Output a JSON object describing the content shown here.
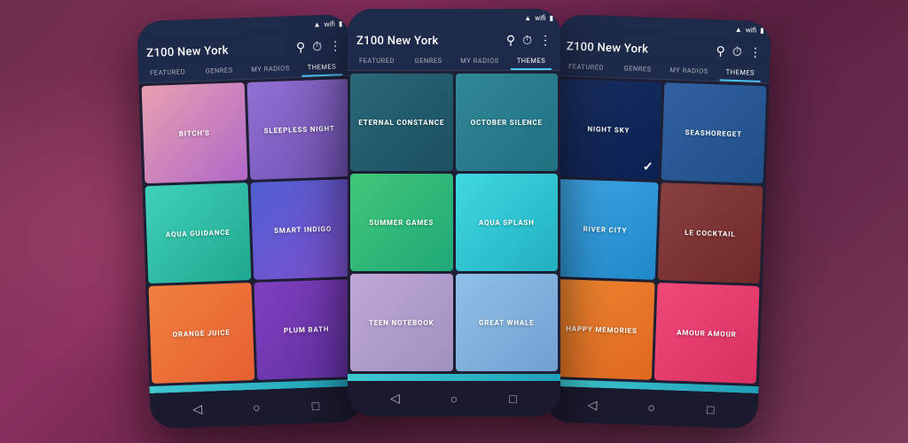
{
  "phones": [
    {
      "id": "phone-1",
      "header": {
        "title": "Z100 New York",
        "icons": [
          "search",
          "alarm",
          "more"
        ]
      },
      "nav": {
        "tabs": [
          "FEATURED",
          "GENRES",
          "MY RADIOS",
          "THEMES"
        ],
        "active": "THEMES"
      },
      "themes": [
        {
          "id": "bitchs",
          "label": "BITCH'S",
          "gradient": "gradient-pink-purple",
          "checked": false
        },
        {
          "id": "sleepless-night",
          "label": "SLEEPLESS NIGHT",
          "gradient": "gradient-light-purple",
          "checked": false
        },
        {
          "id": "aqua-guidance",
          "label": "AQUA GUIDANCE",
          "gradient": "gradient-cyan-teal",
          "checked": false
        },
        {
          "id": "smart-indigo",
          "label": "SMART INDIGO",
          "gradient": "gradient-blue-purple",
          "checked": false
        },
        {
          "id": "orange-juice",
          "label": "ORANGE JUICE",
          "gradient": "gradient-orange",
          "checked": false
        },
        {
          "id": "plum-bath",
          "label": "PLUM BATH",
          "gradient": "gradient-violet",
          "checked": false
        }
      ]
    },
    {
      "id": "phone-2",
      "header": {
        "title": "Z100 New York",
        "icons": [
          "search",
          "alarm",
          "more"
        ]
      },
      "nav": {
        "tabs": [
          "FEATURED",
          "GENRES",
          "MY RADIOS",
          "THEMES"
        ],
        "active": "THEMES"
      },
      "themes": [
        {
          "id": "eternal-constance",
          "label": "ETERNAL CONSTANCE",
          "gradient": "gradient-teal-dark",
          "checked": false
        },
        {
          "id": "october-silence",
          "label": "OCTOBER SILENCE",
          "gradient": "gradient-teal-medium",
          "checked": false
        },
        {
          "id": "summer-games",
          "label": "SUMMER GAMES",
          "gradient": "gradient-green-teal",
          "checked": false
        },
        {
          "id": "aqua-splash",
          "label": "AQUA SPLASH",
          "gradient": "gradient-cyan-blue",
          "checked": false
        },
        {
          "id": "teen-notebook",
          "label": "TEEN NOTEBOOK",
          "gradient": "gradient-lavender",
          "checked": false
        },
        {
          "id": "great-whale",
          "label": "GREAT WHALE",
          "gradient": "gradient-light-blue",
          "checked": false
        }
      ]
    },
    {
      "id": "phone-3",
      "header": {
        "title": "Z100 New York",
        "icons": [
          "search",
          "alarm",
          "more"
        ]
      },
      "nav": {
        "tabs": [
          "FEATURED",
          "GENRES",
          "MY RADIOS",
          "THEMES"
        ],
        "active": "THEMES"
      },
      "themes": [
        {
          "id": "night-sky",
          "label": "NIGHT SKY",
          "gradient": "gradient-blue-dark",
          "checked": true
        },
        {
          "id": "seashoreget",
          "label": "SEASHOREGET",
          "gradient": "gradient-blue-medium",
          "checked": false
        },
        {
          "id": "river-city",
          "label": "RIVER CITY",
          "gradient": "gradient-sky-blue",
          "checked": false
        },
        {
          "id": "le-cocktail",
          "label": "LE COCKTAIL",
          "gradient": "gradient-brown-red",
          "checked": false
        },
        {
          "id": "happy-memories",
          "label": "HAPPY MEMORIES",
          "gradient": "gradient-orange-warm",
          "checked": false
        },
        {
          "id": "amour-amour",
          "label": "AMOUR AMOUR",
          "gradient": "gradient-hot-pink",
          "checked": false
        }
      ]
    }
  ],
  "nav_buttons": [
    "◁",
    "○",
    "□"
  ]
}
